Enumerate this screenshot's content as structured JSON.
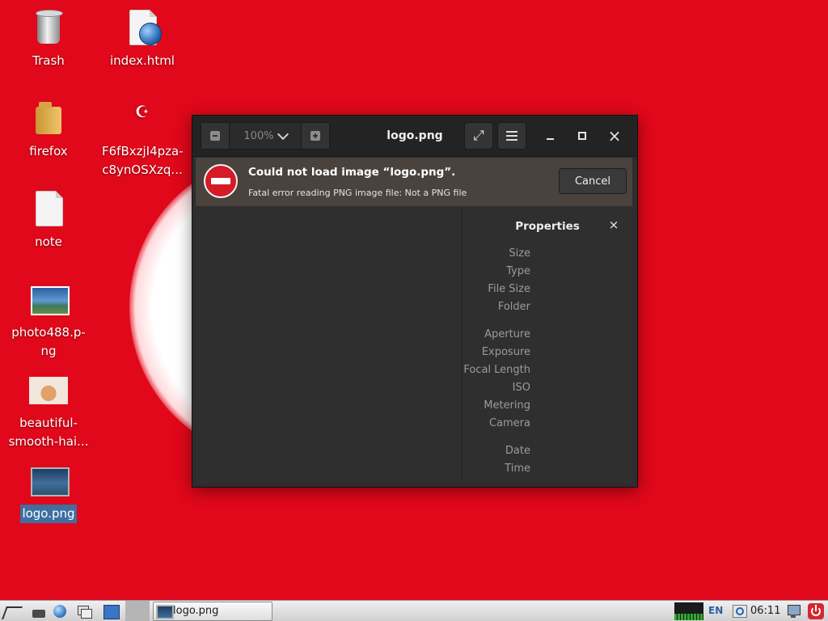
{
  "desktop": {
    "icons": [
      {
        "label": "Trash",
        "icon": "trash-icon"
      },
      {
        "label": "index.html",
        "icon": "html-document-icon"
      },
      {
        "label": "firefox",
        "icon": "folder-icon"
      },
      {
        "label": "F6fBxzjI4pza-c8ynOSXzq...",
        "icon": "turkish-flag-icon"
      },
      {
        "label": "note",
        "icon": "text-document-icon"
      },
      {
        "label": "photo488.p-ng",
        "icon": "image-thumbnail-icon"
      },
      {
        "label": "beautiful-smooth-hai...",
        "icon": "cat-photo-icon"
      },
      {
        "label": "logo.png",
        "icon": "image-thumbnail-icon",
        "selected": true
      }
    ],
    "crescent_glyph": "☪"
  },
  "viewer": {
    "title": "logo.png",
    "zoom": "100%",
    "error": {
      "title": "Could not load image “logo.png”.",
      "detail": "Fatal error reading PNG image file: Not a PNG file",
      "cancel_label": "Cancel"
    },
    "properties": {
      "title": "Properties",
      "close_glyph": "×",
      "labels": {
        "size": "Size",
        "type": "Type",
        "file_size": "File Size",
        "folder": "Folder",
        "aperture": "Aperture",
        "exposure": "Exposure",
        "focal_length": "Focal Length",
        "iso": "ISO",
        "metering": "Metering",
        "camera": "Camera",
        "date": "Date",
        "time": "Time"
      }
    },
    "window_controls": {
      "close_glyph": "×",
      "fullscreen_glyph": "⤢"
    }
  },
  "taskbar": {
    "task_label": "logo.png",
    "language": "EN",
    "clock": "06:11"
  },
  "colors": {
    "wallpaper": "#e0081a",
    "dialog_bg": "#2d2d2d",
    "infobar_bg": "#4a423c",
    "error_red": "#d41b26"
  }
}
